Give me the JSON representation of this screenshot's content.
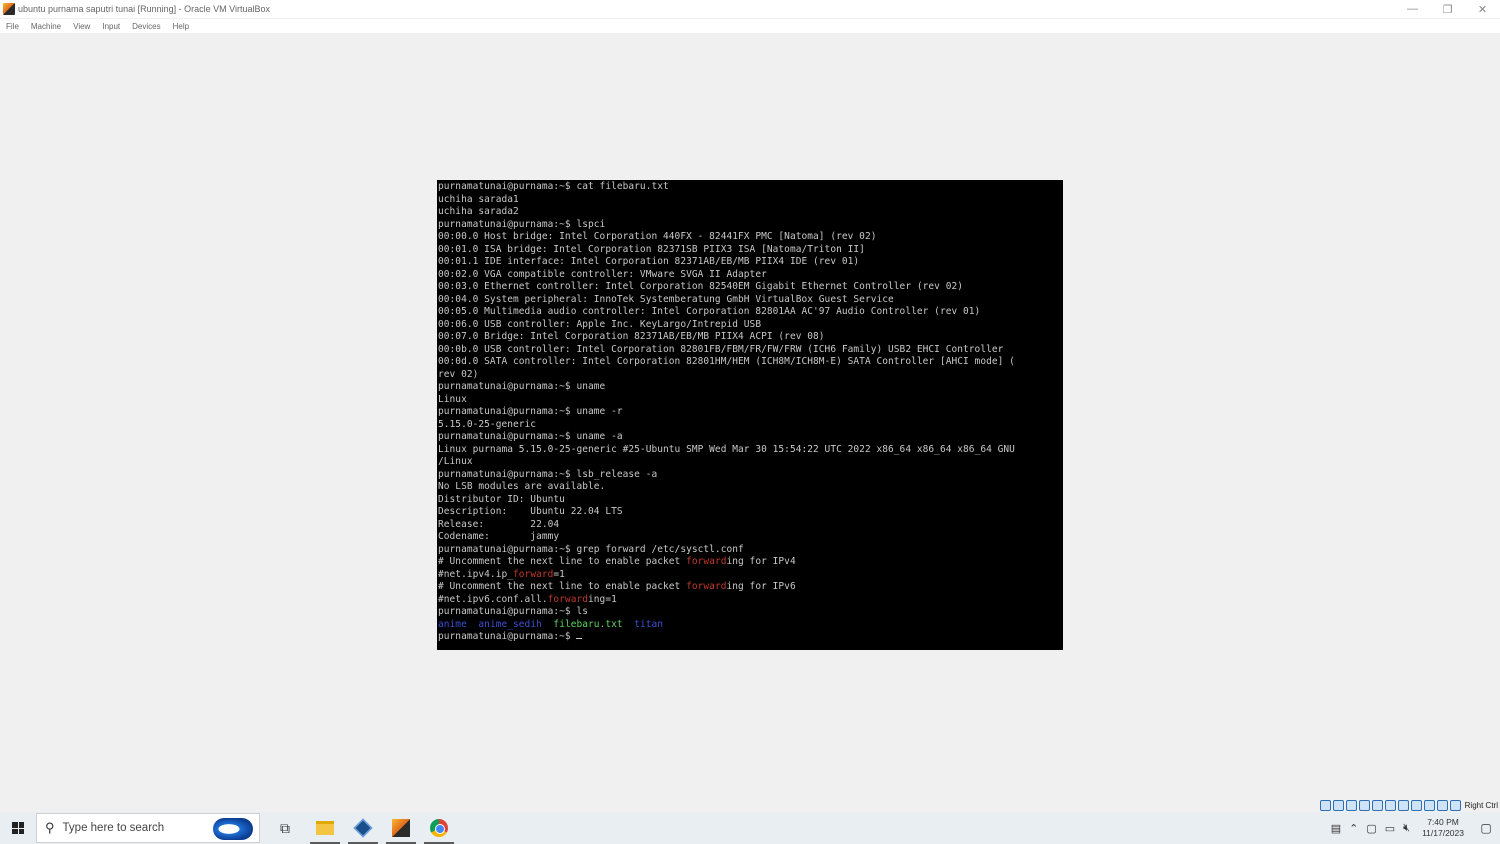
{
  "window": {
    "title": "ubuntu purnama saputri tunai [Running] - Oracle VM VirtualBox",
    "minimize": "—",
    "restore": "❐",
    "close": "✕"
  },
  "menu": [
    "File",
    "Machine",
    "View",
    "Input",
    "Devices",
    "Help"
  ],
  "terminal": {
    "lines": [
      "purnamatunai@purnama:~$ cat filebaru.txt",
      "uchiha sarada1",
      "uchiha sarada2",
      "purnamatunai@purnama:~$ lspci",
      "00:00.0 Host bridge: Intel Corporation 440FX - 82441FX PMC [Natoma] (rev 02)",
      "00:01.0 ISA bridge: Intel Corporation 82371SB PIIX3 ISA [Natoma/Triton II]",
      "00:01.1 IDE interface: Intel Corporation 82371AB/EB/MB PIIX4 IDE (rev 01)",
      "00:02.0 VGA compatible controller: VMware SVGA II Adapter",
      "00:03.0 Ethernet controller: Intel Corporation 82540EM Gigabit Ethernet Controller (rev 02)",
      "00:04.0 System peripheral: InnoTek Systemberatung GmbH VirtualBox Guest Service",
      "00:05.0 Multimedia audio controller: Intel Corporation 82801AA AC'97 Audio Controller (rev 01)",
      "00:06.0 USB controller: Apple Inc. KeyLargo/Intrepid USB",
      "00:07.0 Bridge: Intel Corporation 82371AB/EB/MB PIIX4 ACPI (rev 08)",
      "00:0b.0 USB controller: Intel Corporation 82801FB/FBM/FR/FW/FRW (ICH6 Family) USB2 EHCI Controller",
      "00:0d.0 SATA controller: Intel Corporation 82801HM/HEM (ICH8M/ICH8M-E) SATA Controller [AHCI mode] (",
      "rev 02)",
      "purnamatunai@purnama:~$ uname",
      "Linux",
      "purnamatunai@purnama:~$ uname -r",
      "5.15.0-25-generic",
      "purnamatunai@purnama:~$ uname -a",
      "Linux purnama 5.15.0-25-generic #25-Ubuntu SMP Wed Mar 30 15:54:22 UTC 2022 x86_64 x86_64 x86_64 GNU",
      "/Linux",
      "purnamatunai@purnama:~$ lsb_release -a",
      "No LSB modules are available.",
      "Distributor ID: Ubuntu",
      "Description:    Ubuntu 22.04 LTS",
      "Release:        22.04",
      "Codename:       jammy",
      "purnamatunai@purnama:~$ grep forward /etc/sysctl.conf"
    ],
    "grep_lines": [
      {
        "pre": "# Uncomment the next line to enable packet ",
        "hl": "forward",
        "post": "ing for IPv4"
      },
      {
        "pre": "#net.ipv4.ip_",
        "hl": "forward",
        "post": "=1"
      },
      {
        "pre": "# Uncomment the next line to enable packet ",
        "hl": "forward",
        "post": "ing for IPv6"
      },
      {
        "pre": "#net.ipv6.conf.all.",
        "hl": "forward",
        "post": "ing=1"
      }
    ],
    "ls_prompt": "purnamatunai@purnama:~$ ls",
    "ls_items": {
      "dir1": "anime",
      "dir2": "anime_sedih",
      "file": "filebaru.txt",
      "dir3": "titan"
    },
    "final_prompt": "purnamatunai@purnama:~$ "
  },
  "statusbar": {
    "host_key": "Right Ctrl"
  },
  "taskbar": {
    "search_placeholder": "Type here to search",
    "time": "7:40 PM",
    "date": "11/17/2023"
  },
  "colors": {
    "terminal_bg": "#000000",
    "terminal_fg": "#c8c8c8",
    "grep_highlight": "#c0392b",
    "ls_dir": "#3b4fd1",
    "ls_file": "#5fd35f"
  }
}
